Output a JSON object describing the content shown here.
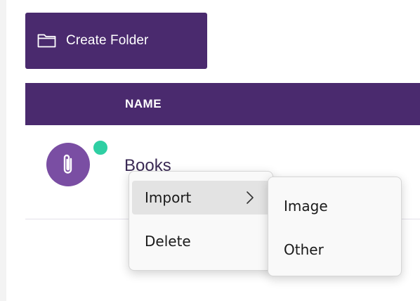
{
  "toolbar": {
    "create_folder_label": "Create Folder",
    "create_folder_icon": "folder-icon"
  },
  "table": {
    "columns": [
      "NAME"
    ],
    "rows": [
      {
        "name": "Books",
        "icon": "paperclip-icon",
        "status_color": "#2ecfa3"
      }
    ]
  },
  "context_menu": {
    "items": [
      {
        "label": "Import",
        "has_submenu": true,
        "highlighted": true
      },
      {
        "label": "Delete",
        "has_submenu": false,
        "highlighted": false
      }
    ],
    "submenu": {
      "parent": "Import",
      "items": [
        {
          "label": "Image"
        },
        {
          "label": "Other"
        }
      ]
    }
  },
  "colors": {
    "accent": "#4a2a6e",
    "avatar": "#7a4ea3",
    "status_online": "#2ecfa3",
    "menu_background": "#f9f9f9",
    "menu_highlight": "#e3e3e3"
  }
}
